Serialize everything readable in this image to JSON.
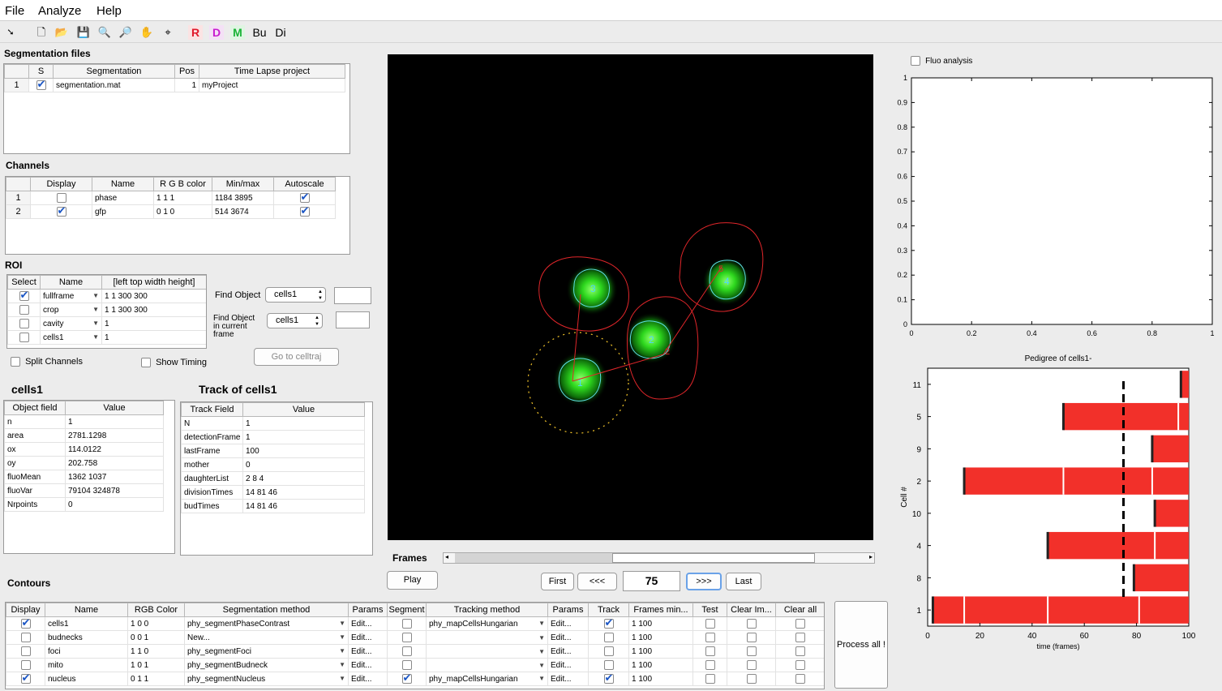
{
  "menu": [
    "File",
    "Analyze",
    "Help"
  ],
  "toolbar": {
    "letters": [
      "R",
      "D",
      "M",
      "Bu",
      "Di"
    ],
    "letter_colors": [
      "#e0192b",
      "#c81ccf",
      "#19b336",
      "#000000",
      "#000000"
    ]
  },
  "segfiles": {
    "title": "Segmentation files",
    "headers": [
      "",
      "S",
      "Segmentation",
      "Pos",
      "Time Lapse project"
    ],
    "rows": [
      {
        "n": "1",
        "s": true,
        "seg": "segmentation.mat",
        "pos": "1",
        "proj": "myProject"
      }
    ]
  },
  "channels": {
    "title": "Channels",
    "headers": [
      "",
      "Display",
      "Name",
      "R G B color",
      "Min/max",
      "Autoscale"
    ],
    "rows": [
      {
        "n": "1",
        "display": false,
        "name": "phase",
        "rgb": "1  1  1",
        "minmax": "1184 3895",
        "auto": true
      },
      {
        "n": "2",
        "display": true,
        "name": "gfp",
        "rgb": "0 1 0",
        "minmax": "514 3674",
        "auto": true
      }
    ]
  },
  "roi": {
    "title": "ROI",
    "headers": [
      "Select",
      "Name",
      "[left top width height]"
    ],
    "rows": [
      {
        "sel": true,
        "name": "fullframe",
        "val": "1    1  300  300"
      },
      {
        "sel": false,
        "name": "crop",
        "val": "1    1  300  300"
      },
      {
        "sel": false,
        "name": "cavity",
        "val": "1"
      },
      {
        "sel": false,
        "name": "cells1",
        "val": "1"
      }
    ],
    "find_object": "Find Object",
    "find_object_current": "Find Object in current frame",
    "find_value": "cells1",
    "find_value2": "cells1",
    "goto": "Go to celltraj",
    "split": "Split Channels",
    "timing": "Show Timing"
  },
  "objinfo": {
    "title": "cells1",
    "headers": [
      "Object field",
      "Value"
    ],
    "rows": [
      [
        "n",
        "1"
      ],
      [
        "area",
        "2781.1298"
      ],
      [
        "ox",
        "114.0122"
      ],
      [
        "oy",
        "202.758"
      ],
      [
        "fluoMean",
        "1362  1037"
      ],
      [
        "fluoVar",
        "79104  324878"
      ],
      [
        "Nrpoints",
        "0"
      ]
    ]
  },
  "trackinfo": {
    "title": "Track of cells1",
    "headers": [
      "Track Field",
      "Value"
    ],
    "rows": [
      [
        "N",
        "1"
      ],
      [
        "detectionFrame",
        "1"
      ],
      [
        "lastFrame",
        "100"
      ],
      [
        "mother",
        "0"
      ],
      [
        "daughterList",
        "2  8  4"
      ],
      [
        "divisionTimes",
        "14  81  46"
      ],
      [
        "budTimes",
        "14  81  46"
      ]
    ]
  },
  "image": {
    "cells": [
      {
        "label": "3"
      },
      {
        "label": "4"
      },
      {
        "label": "2"
      },
      {
        "label": "1"
      }
    ],
    "div_labels": [
      "5",
      "2"
    ]
  },
  "frames": {
    "label": "Frames",
    "value": "75",
    "slider_fraction": 0.38,
    "buttons": [
      "Play",
      "First",
      "<<<",
      ">>>",
      "Last"
    ]
  },
  "contours": {
    "title": "Contours",
    "headers": [
      "Display",
      "Name",
      "RGB Color",
      "Segmentation method",
      "Params",
      "Segment",
      "Tracking method",
      "Params",
      "Track",
      "Frames min...",
      "Test",
      "Clear Im...",
      "Clear all"
    ],
    "rows": [
      {
        "d": true,
        "name": "cells1",
        "rgb": "1  0  0",
        "seg": "phy_segmentPhaseContrast",
        "p": "Edit...",
        "s": false,
        "track": "phy_mapCellsHungarian",
        "p2": "Edit...",
        "t": true,
        "fr": "1  100"
      },
      {
        "d": false,
        "name": "budnecks",
        "rgb": "0  0  1",
        "seg": "New...",
        "p": "Edit...",
        "s": false,
        "track": "",
        "p2": "Edit...",
        "t": false,
        "fr": "1  100"
      },
      {
        "d": false,
        "name": "foci",
        "rgb": "1  1  0",
        "seg": "phy_segmentFoci",
        "p": "Edit...",
        "s": false,
        "track": "",
        "p2": "Edit...",
        "t": false,
        "fr": "1  100"
      },
      {
        "d": false,
        "name": "mito",
        "rgb": "1  0  1",
        "seg": "phy_segmentBudneck",
        "p": "Edit...",
        "s": false,
        "track": "",
        "p2": "Edit...",
        "t": false,
        "fr": "1  100"
      },
      {
        "d": true,
        "name": "nucleus",
        "rgb": "0  1  1",
        "seg": "phy_segmentNucleus",
        "p": "Edit...",
        "s": true,
        "track": "phy_mapCellsHungarian",
        "p2": "Edit...",
        "t": true,
        "fr": "1  100"
      }
    ],
    "process_all": "Process all !"
  },
  "fluo": {
    "checkbox_label": "Fluo analysis"
  },
  "chart_data": [
    {
      "type": "line",
      "title": "",
      "xlim": [
        0,
        1
      ],
      "ylim": [
        0,
        1
      ],
      "xticks": [
        "0",
        "0.2",
        "0.4",
        "0.6",
        "0.8",
        "1"
      ],
      "yticks": [
        "0",
        "0.1",
        "0.2",
        "0.3",
        "0.4",
        "0.5",
        "0.6",
        "0.7",
        "0.8",
        "0.9",
        "1"
      ],
      "series": []
    },
    {
      "type": "bar",
      "title": "Pedigree of cells1-",
      "xlabel": "time (frames)",
      "ylabel": "Cell #",
      "xlim": [
        0,
        100
      ],
      "xticks": [
        "0",
        "20",
        "40",
        "60",
        "80",
        "100"
      ],
      "categories": [
        "11",
        "5",
        "9",
        "2",
        "10",
        "4",
        "8",
        "1"
      ],
      "bars": [
        {
          "cell": "11",
          "start": 97,
          "end": 100,
          "divisions": []
        },
        {
          "cell": "5",
          "start": 52,
          "end": 100,
          "divisions": [
            96
          ]
        },
        {
          "cell": "9",
          "start": 86,
          "end": 100,
          "divisions": []
        },
        {
          "cell": "2",
          "start": 14,
          "end": 100,
          "divisions": [
            52,
            86
          ]
        },
        {
          "cell": "10",
          "start": 87,
          "end": 100,
          "divisions": []
        },
        {
          "cell": "4",
          "start": 46,
          "end": 100,
          "divisions": [
            87
          ]
        },
        {
          "cell": "8",
          "start": 79,
          "end": 100,
          "divisions": []
        },
        {
          "cell": "1",
          "start": 2,
          "end": 100,
          "divisions": [
            14,
            46,
            81
          ]
        }
      ],
      "current_frame": 75,
      "bar_color": "#f2302a"
    }
  ]
}
